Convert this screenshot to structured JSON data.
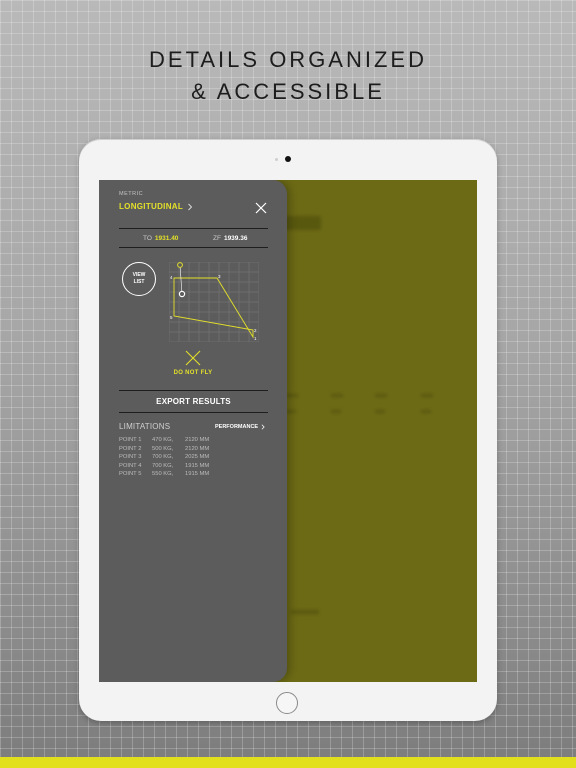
{
  "headline": {
    "line1": "DETAILS ORGANIZED",
    "line2": "& ACCESSIBLE"
  },
  "colors": {
    "accent": "#e3e02a",
    "screen_background": "#6c6a15",
    "panel_background": "#5c5c5c"
  },
  "panel": {
    "unit_system": "METRIC",
    "view_title": "LONGITUDINAL",
    "close_icon": "close-icon",
    "cg": {
      "to_label": "TO",
      "to_value": "1931.40",
      "zf_label": "ZF",
      "zf_value": "1939.36"
    },
    "view_list": {
      "line1": "VIEW",
      "line2": "LIST"
    },
    "envelope": {
      "vertex_labels": [
        "4",
        "3",
        "5",
        "2",
        "1"
      ],
      "status_icon": "x-icon",
      "status_text": "DO NOT FLY"
    },
    "export_label": "EXPORT RESULTS",
    "limitations": {
      "title": "LIMITATIONS",
      "link_label": "PERFORMANCE",
      "points": [
        {
          "name": "POINT 1",
          "weight": "470 KG,",
          "arm": "2120 MM"
        },
        {
          "name": "POINT 2",
          "weight": "500 KG,",
          "arm": "2120 MM"
        },
        {
          "name": "POINT 3",
          "weight": "700 KG,",
          "arm": "2025 MM"
        },
        {
          "name": "POINT 4",
          "weight": "700 KG,",
          "arm": "1915 MM"
        },
        {
          "name": "POINT 5",
          "weight": "550 KG,",
          "arm": "1915 MM"
        }
      ]
    }
  }
}
